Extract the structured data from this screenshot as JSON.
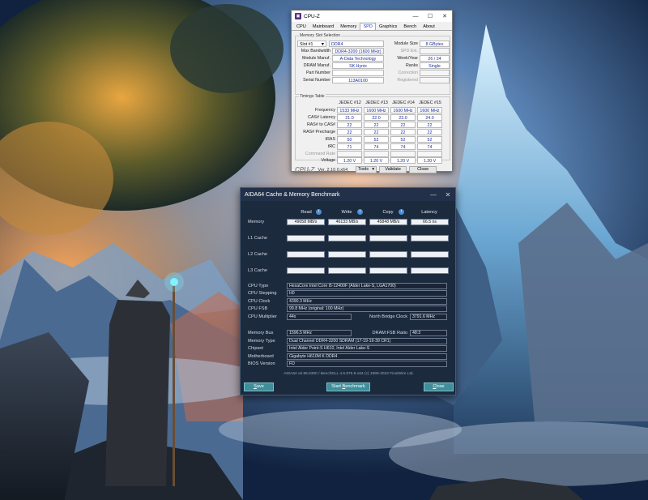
{
  "colors": {
    "cpuz_value_text": "#1a2d9c",
    "aida_bg": "#1c2a3e",
    "aida_button": "#3f8e9a"
  },
  "cpuz": {
    "title": "CPU-Z",
    "window_controls": {
      "minimize": "—",
      "maximize": "☐",
      "close": "✕"
    },
    "tabs": [
      "CPU",
      "Mainboard",
      "Memory",
      "SPD",
      "Graphics",
      "Bench",
      "About"
    ],
    "active_tab": "SPD",
    "slot_section": {
      "label": "Memory Slot Selection",
      "slot": "Slot #1",
      "type": "DDR4",
      "module_size_label": "Module Size",
      "module_size": "8 GBytes",
      "max_bandwidth_label": "Max Bandwidth",
      "max_bandwidth": "DDR4-3200 (1600 MHz)",
      "spd_ext_label": "SPD Ext.",
      "module_manuf_label": "Module Manuf.",
      "module_manuf": "A-Data Technology",
      "week_year_label": "Week/Year",
      "week_year": "26 / 24",
      "dram_manuf_label": "DRAM Manuf.",
      "dram_manuf": "SK Hynix",
      "ranks_label": "Ranks",
      "ranks": "Single",
      "part_number_label": "Part Number",
      "correction_label": "Correction",
      "serial_number_label": "Serial Number",
      "serial_number": "113A0100",
      "registered_label": "Registered"
    },
    "timings": {
      "label": "Timings Table",
      "columns": [
        "JEDEC #12",
        "JEDEC #13",
        "JEDEC #14",
        "JEDEC #15"
      ],
      "rows": [
        {
          "label": "Frequency",
          "values": [
            "1533 MHz",
            "1600 MHz",
            "1600 MHz",
            "1600 MHz"
          ]
        },
        {
          "label": "CAS# Latency",
          "values": [
            "21.0",
            "22.0",
            "23.0",
            "24.0"
          ]
        },
        {
          "label": "RAS# to CAS#",
          "values": [
            "22",
            "22",
            "22",
            "22"
          ]
        },
        {
          "label": "RAS# Precharge",
          "values": [
            "22",
            "22",
            "22",
            "22"
          ]
        },
        {
          "label": "tRAS",
          "values": [
            "50",
            "52",
            "52",
            "52"
          ]
        },
        {
          "label": "tRC",
          "values": [
            "71",
            "74",
            "74",
            "74"
          ]
        },
        {
          "label": "Command Rate",
          "values": [
            "",
            "",
            "",
            ""
          ]
        },
        {
          "label": "Voltage",
          "values": [
            "1.20 V",
            "1.20 V",
            "1.20 V",
            "1.20 V"
          ]
        }
      ]
    },
    "footer": {
      "brand": "CPU-Z",
      "version": "Ver. 2.10.0.x64",
      "tools": "Tools",
      "validate": "Validate",
      "close": "Close"
    }
  },
  "aida": {
    "title": "AIDA64 Cache & Memory Benchmark",
    "window_controls": {
      "minimize": "—",
      "close": "✕"
    },
    "columns": {
      "read": "Read",
      "write": "Write",
      "copy": "Copy",
      "latency": "Latency"
    },
    "bench_rows": [
      {
        "label": "Memory",
        "read": "49058 MB/s",
        "write": "46133 MB/s",
        "copy": "45848 MB/s",
        "latency": "66.5 ns"
      },
      {
        "label": "L1 Cache",
        "read": "",
        "write": "",
        "copy": "",
        "latency": ""
      },
      {
        "label": "L2 Cache",
        "read": "",
        "write": "",
        "copy": "",
        "latency": ""
      },
      {
        "label": "L3 Cache",
        "read": "",
        "write": "",
        "copy": "",
        "latency": ""
      }
    ],
    "cpu": {
      "type_label": "CPU Type",
      "type": "HexaCore Intel Core i5-12400F (Alder Lake-S, LGA1700)",
      "stepping_label": "CPU Stepping",
      "stepping": "H0",
      "clock_label": "CPU Clock",
      "clock": "4390.3 MHz",
      "fsb_label": "CPU FSB",
      "fsb": "99.8 MHz  (original: 100 MHz)",
      "multiplier_label": "CPU Multiplier",
      "multiplier": "44x",
      "nb_clock_label": "North Bridge Clock",
      "nb_clock": "3791.6 MHz"
    },
    "memory": {
      "bus_label": "Memory Bus",
      "bus": "1596.5 MHz",
      "ratio_label": "DRAM:FSB Ratio",
      "ratio": "48:3",
      "type_label": "Memory Type",
      "type": "Dual Channel DDR4-3200 SDRAM  (17-19-19-39 CR1)",
      "chipset_label": "Chipset",
      "chipset": "Intel Alder Point-S H610, Intel Alder Lake-S",
      "motherboard_label": "Motherboard",
      "motherboard": "Gigabyte H610M K DDR4",
      "bios_label": "BIOS Version",
      "bios": "FD"
    },
    "copyright": "AIDA64 v6.85.6300 / BenchDLL 4.6.875.8-x64  (c) 1995-2022 FinalWire Ltd.",
    "buttons": {
      "save_mn": "S",
      "save_rest": "ave",
      "start_prefix": "Start ",
      "start_mn": "B",
      "start_rest": "enchmark",
      "close_mn": "C",
      "close_rest": "lose"
    }
  }
}
